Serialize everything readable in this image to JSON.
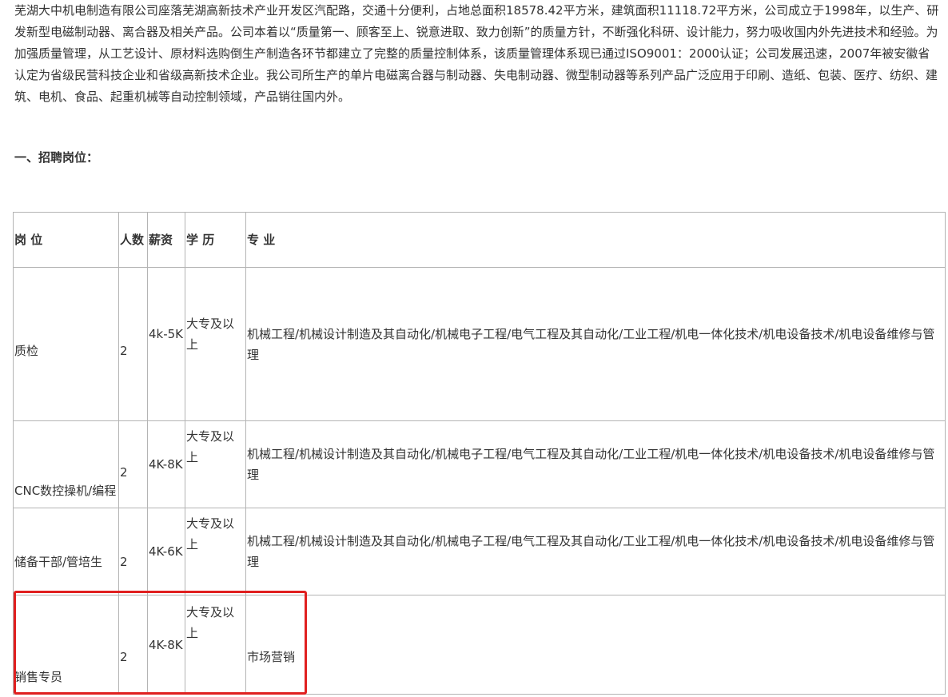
{
  "intro": {
    "text": "芜湖大中机电制造有限公司座落芜湖高新技术产业开发区汽配路，交通十分便利，占地总面积18578.42平方米，建筑面积11118.72平方米，公司成立于1998年，以生产、研发新型电磁制动器、离合器及相关产品。公司本着以“质量第一、顾客至上、锐意进取、致力创新”的质量方针，不断强化科研、设计能力，努力吸收国内外先进技术和经验。为加强质量管理，从工艺设计、原材料选购倒生产制造各环节都建立了完整的质量控制体系，该质量管理体系现已通过ISO9001：2000认证；公司发展迅速，2007年被安徽省认定为省级民营科技企业和省级高新技术企业。我公司所生产的单片电磁离合器与制动器、失电制动器、微型制动器等系列产品广泛应用于印刷、造纸、包装、医疗、纺织、建筑、电机、食品、起重机械等自动控制领域，产品销往国内外。"
  },
  "section": {
    "title": "一、招聘岗位："
  },
  "table": {
    "headers": {
      "post": "岗 位",
      "num": "人数",
      "pay": "薪资",
      "edu": "学 历",
      "major": "专 业"
    },
    "rows": [
      {
        "post": "质检",
        "num": "2",
        "pay": "4k-5K",
        "edu": "大专及以上",
        "major": "机械工程/机械设计制造及其自动化/机械电子工程/电气工程及其自动化/工业工程/机电一体化技术/机电设备技术/机电设备维修与管理"
      },
      {
        "post": "CNC数控操机/编程",
        "num": "2",
        "pay": "4K-8K",
        "edu": "大专及以上",
        "major": "机械工程/机械设计制造及其自动化/机械电子工程/电气工程及其自动化/工业工程/机电一体化技术/机电设备技术/机电设备维修与管理"
      },
      {
        "post": "储备干部/管培生",
        "num": "2",
        "pay": "4K-6K",
        "edu": "大专及以上",
        "major": "机械工程/机械设计制造及其自动化/机械电子工程/电气工程及其自动化/工业工程/机电一体化技术/机电设备技术/机电设备维修与管理"
      },
      {
        "post": "销售专员",
        "num": "2",
        "pay": "4K-8K",
        "edu": "大专及以上",
        "major": "市场营销"
      }
    ]
  },
  "colors": {
    "text": "#333333",
    "border": "#b4b4b4",
    "highlight": "#e02020"
  }
}
